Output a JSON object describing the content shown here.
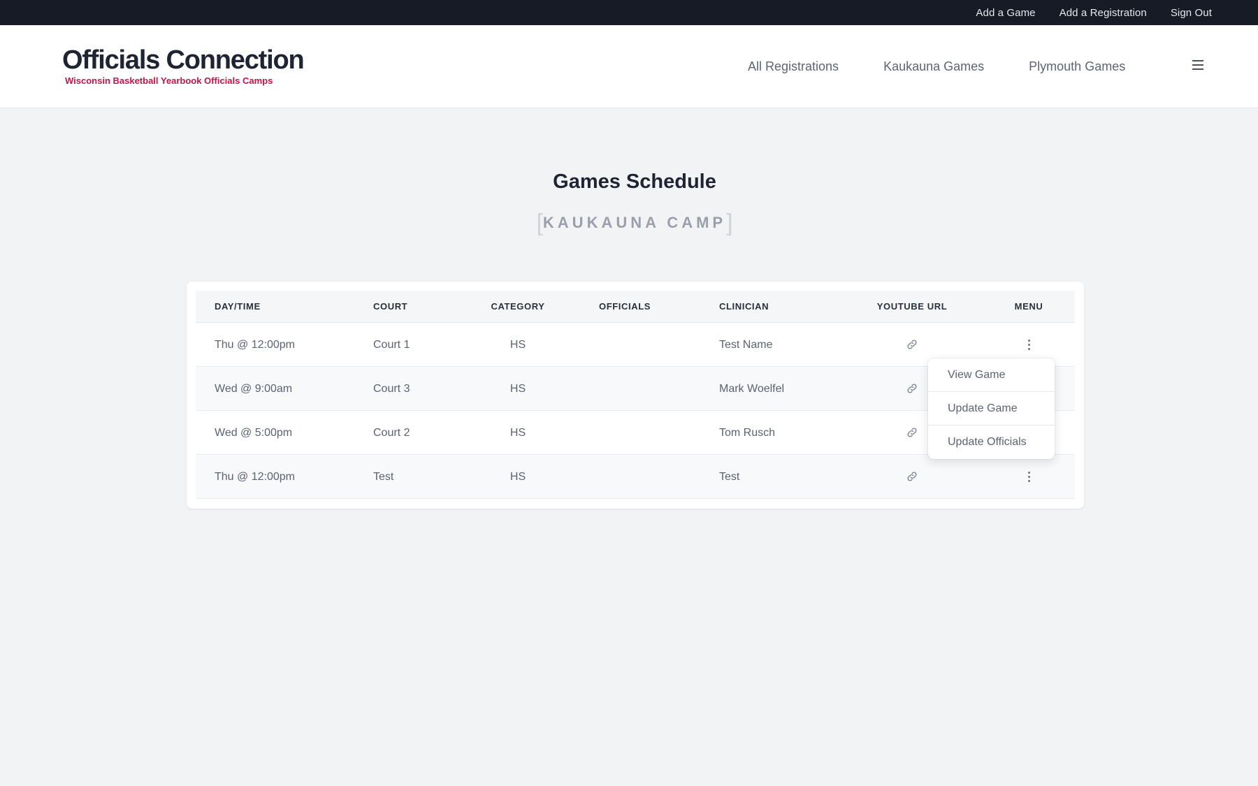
{
  "topbar": {
    "links": [
      "Add a Game",
      "Add a Registration",
      "Sign Out"
    ]
  },
  "brand": {
    "title": "Officials Connection",
    "subtitle": "Wisconsin Basketball Yearbook Officials Camps"
  },
  "nav": {
    "items": [
      "All Registrations",
      "Kaukauna Games",
      "Plymouth Games"
    ],
    "menu_icon": "hamburger-icon"
  },
  "page": {
    "title": "Games Schedule",
    "camp": "KAUKAUNA CAMP",
    "bracket_open": "[",
    "bracket_close": "]"
  },
  "table": {
    "columns": [
      "DAY/TIME",
      "COURT",
      "CATEGORY",
      "OFFICIALS",
      "CLINICIAN",
      "YOUTUBE URL",
      "MENU"
    ],
    "rows": [
      {
        "daytime": "Thu @ 12:00pm",
        "court": "Court 1",
        "category": "HS",
        "officials": "",
        "clinician": "Test Name"
      },
      {
        "daytime": "Wed @ 9:00am",
        "court": "Court 3",
        "category": "HS",
        "officials": "",
        "clinician": "Mark Woelfel"
      },
      {
        "daytime": "Wed @ 5:00pm",
        "court": "Court 2",
        "category": "HS",
        "officials": "",
        "clinician": "Tom Rusch"
      },
      {
        "daytime": "Thu @ 12:00pm",
        "court": "Test",
        "category": "HS",
        "officials": "",
        "clinician": "Test"
      }
    ]
  },
  "dropdown": {
    "items": [
      "View Game",
      "Update Game",
      "Update Officials"
    ]
  },
  "colors": {
    "topbar": "#171b26",
    "accent": "#be1748",
    "background": "#f2f3f5"
  },
  "icons": {
    "youtube": "link-icon",
    "menu": "kebab-menu-icon"
  }
}
